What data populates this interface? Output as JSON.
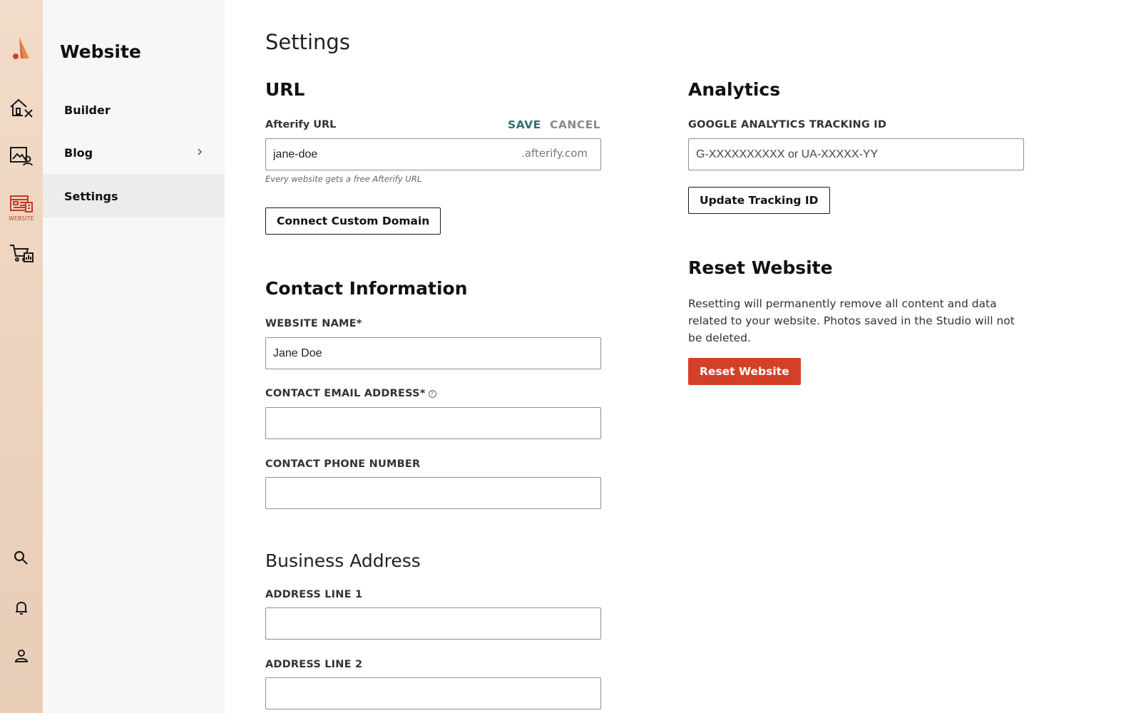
{
  "rail": {
    "website_caption": "WEBSITE"
  },
  "sidebar": {
    "title": "Website",
    "items": [
      {
        "label": "Builder"
      },
      {
        "label": "Blog"
      },
      {
        "label": "Settings"
      }
    ]
  },
  "page": {
    "title": "Settings"
  },
  "url_section": {
    "heading": "URL",
    "label": "Afterify URL",
    "save": "SAVE",
    "cancel": "CANCEL",
    "value": "jane-doe",
    "suffix": ".afterify.com",
    "hint": "Every website gets a free Afterify URL",
    "connect_button": "Connect Custom Domain"
  },
  "contact": {
    "heading": "Contact Information",
    "name_label": "WEBSITE NAME*",
    "name_value": "Jane Doe",
    "email_label": "CONTACT EMAIL ADDRESS*",
    "email_help": "?",
    "email_value": "",
    "phone_label": "CONTACT PHONE NUMBER",
    "phone_value": ""
  },
  "address": {
    "heading": "Business Address",
    "line1_label": "ADDRESS LINE 1",
    "line1_value": "",
    "line2_label": "ADDRESS LINE 2",
    "line2_value": ""
  },
  "analytics": {
    "heading": "Analytics",
    "label": "GOOGLE ANALYTICS TRACKING ID",
    "placeholder": "G-XXXXXXXXXX or UA-XXXXX-YY",
    "button": "Update Tracking ID"
  },
  "reset": {
    "heading": "Reset Website",
    "text": "Resetting will permanently remove all content and data related to your website. Photos saved in the Studio will not be deleted.",
    "button": "Reset Website"
  },
  "colors": {
    "accent_red": "#d2402a",
    "save_teal": "#2f6e73",
    "rail_bg": "#ecd3be"
  }
}
